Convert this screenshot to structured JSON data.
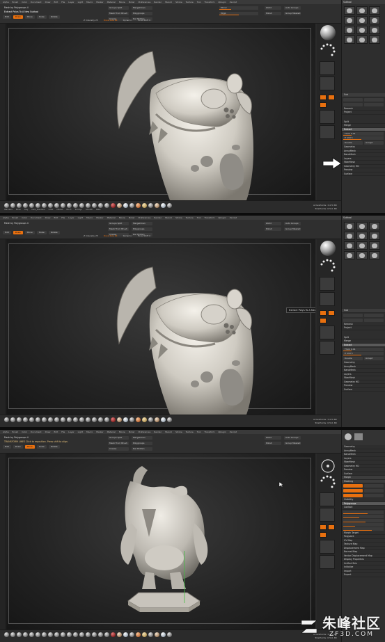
{
  "app": {
    "menu_items": [
      "Alpha",
      "Brush",
      "Color",
      "Document",
      "Draw",
      "Edit",
      "File",
      "Layer",
      "Light",
      "Macro",
      "Marker",
      "Material",
      "Movie",
      "Picker",
      "Preferences",
      "Render",
      "Stencil",
      "Stroke",
      "Texture",
      "Tool",
      "Transform",
      "Zplugin",
      "Zscript"
    ]
  },
  "panel1": {
    "tool_label": "Mesh by Polygroups 4",
    "subtool_title": "Extract Polys To A New Subtool",
    "modes": {
      "edit": "Edit",
      "draw": "Draw",
      "move": "Move",
      "scale": "Scale",
      "rotate": "Rotate"
    },
    "top_buttons": [
      "Groups Split",
      "MergeDown",
      "Mesh From Brush",
      "Polygroups",
      "Crease",
      "Del Hidden"
    ],
    "sliders": [
      "Mirror",
      "Mrgb",
      "Z Intensity 25"
    ],
    "right_tools": [
      "ZAdd",
      "Auto Groups",
      "Polish",
      "Group Masked"
    ],
    "stats": {
      "zadd": "Z Intensity 25",
      "draw_size": "Draw Size 64",
      "dynamic": "Dynamic",
      "focal": "Focal Shift 0"
    },
    "strip_stats": [
      "ActivePoints: 3,470 Mil",
      "TotalPoints: 6.511 Mil"
    ],
    "strip_labels": [
      "Standard",
      "Move",
      "Clay",
      "Dam_Standard",
      "Inflat",
      "hPolish",
      "Pinch",
      "TrimDyn",
      "Smooth",
      "Rake"
    ]
  },
  "panel2": {
    "tool_label": "Mesh by Polygroups 4",
    "tooltip": "Extract Polys To A New Subtool",
    "strip_stats": [
      "ActivePoints: 3,470 Mil",
      "TotalPoints: 6.511 Mil"
    ]
  },
  "panel3": {
    "tool_label": "Mesh by Polygroups 4",
    "hint": "TRANSFORM LINES Click to reposition. Press shift to align.",
    "strip_stats": [
      "ActivePoints: 3,470 Mil",
      "TotalPoints: 6.511 Mil"
    ]
  },
  "right_panel": {
    "title": "Subtool",
    "items": [
      "Sub",
      "Remesh",
      "Project",
      "Split",
      "Merge",
      "Extract",
      "Geometry",
      "ArrayMesh",
      "NanoMesh",
      "Layers",
      "FiberMesh",
      "Geometry HD",
      "Preview",
      "Surface"
    ],
    "sliders": [
      "Thick 0.01",
      "E Smt 5",
      "Double",
      "Accept"
    ],
    "list3": [
      "Morph",
      "Masking",
      "Visibility",
      "Polygroups",
      "Contact",
      "Morph Target",
      "Polypaint",
      "UV Map",
      "Texture Map",
      "Displacement Map",
      "Normal Map",
      "Vector Displacement Map",
      "Display Properties",
      "Unified Skin",
      "Initialize",
      "Import",
      "Export"
    ]
  },
  "watermark": {
    "main": "朱峰社区",
    "sub": "ZF3D.COM"
  }
}
